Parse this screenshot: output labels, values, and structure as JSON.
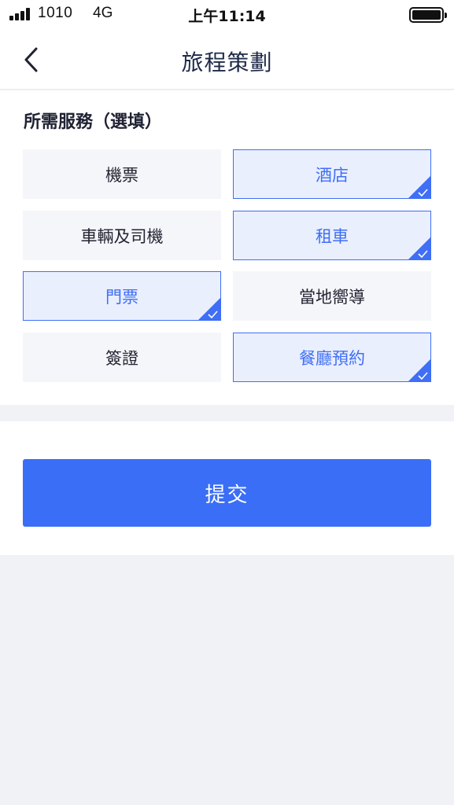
{
  "status_bar": {
    "carrier": "1010",
    "network": "4G",
    "time": "上午11:14"
  },
  "nav": {
    "title": "旅程策劃",
    "back_icon": "chevron-left-icon"
  },
  "services": {
    "title": "所需服務（選填）",
    "options": [
      {
        "label": "機票",
        "selected": false
      },
      {
        "label": "酒店",
        "selected": true
      },
      {
        "label": "車輛及司機",
        "selected": false
      },
      {
        "label": "租車",
        "selected": true
      },
      {
        "label": "門票",
        "selected": true
      },
      {
        "label": "當地嚮導",
        "selected": false
      },
      {
        "label": "簽證",
        "selected": false
      },
      {
        "label": "餐廳預約",
        "selected": true
      }
    ],
    "check_icon": "checkmark-corner-icon"
  },
  "submit": {
    "label": "提交"
  },
  "colors": {
    "accent": "#3a6ef6",
    "selected_bg": "#eaeffe",
    "unselected_bg": "#f5f6fa",
    "page_bg": "#f0f2f6"
  }
}
